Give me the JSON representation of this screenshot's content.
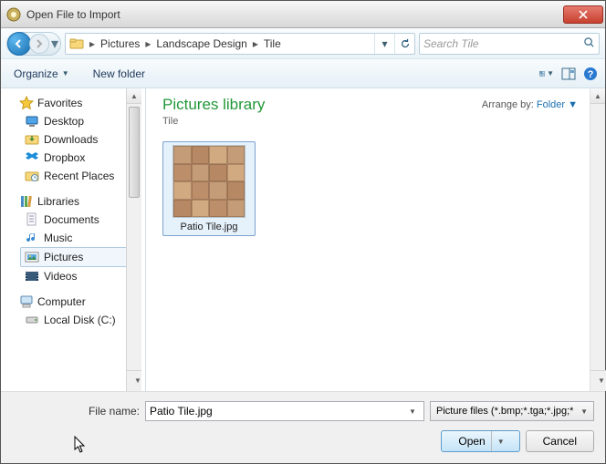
{
  "title": "Open File to Import",
  "breadcrumb": {
    "seg1": "Pictures",
    "seg2": "Landscape Design",
    "seg3": "Tile"
  },
  "search": {
    "placeholder": "Search Tile"
  },
  "toolbar": {
    "organize": "Organize",
    "newfolder": "New folder"
  },
  "tree": {
    "favorites": "Favorites",
    "desktop": "Desktop",
    "downloads": "Downloads",
    "dropbox": "Dropbox",
    "recent": "Recent Places",
    "libraries": "Libraries",
    "documents": "Documents",
    "music": "Music",
    "pictures": "Pictures",
    "videos": "Videos",
    "computer": "Computer",
    "localdisk": "Local Disk (C:)"
  },
  "content": {
    "title": "Pictures library",
    "subtitle": "Tile",
    "arrange_label": "Arrange by:",
    "arrange_value": "Folder",
    "file1": "Patio Tile.jpg"
  },
  "footer": {
    "filename_label": "File name:",
    "filename_value": "Patio Tile.jpg",
    "filetype": "Picture files (*.bmp;*.tga;*.jpg;*",
    "open": "Open",
    "cancel": "Cancel"
  }
}
